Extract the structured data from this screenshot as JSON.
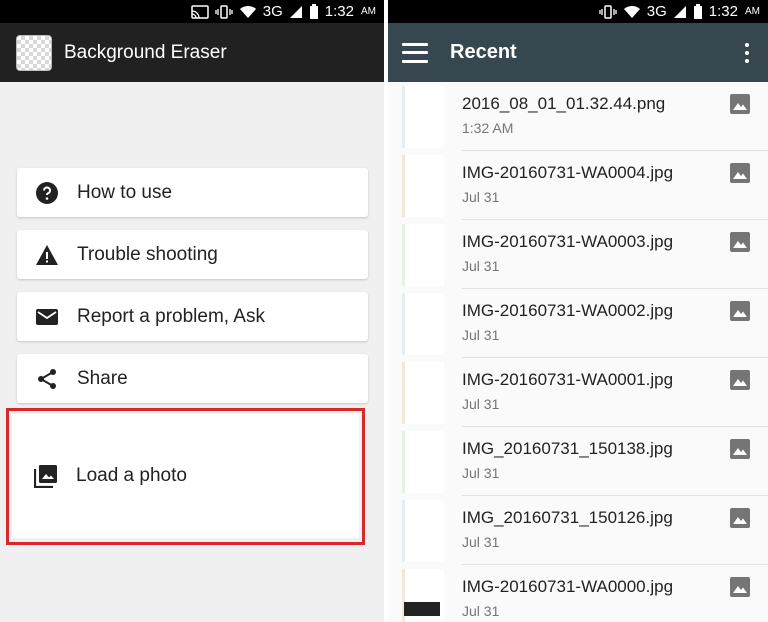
{
  "status": {
    "left_time": "1:32",
    "right_time": "1:32",
    "ampm": "AM",
    "network": "3G"
  },
  "left_app": {
    "title": "Background Eraser",
    "menu": [
      {
        "label": "How to use",
        "icon": "help-circle-icon"
      },
      {
        "label": "Trouble shooting",
        "icon": "warning-icon"
      },
      {
        "label": "Report a problem, Ask",
        "icon": "email-icon"
      },
      {
        "label": "Share",
        "icon": "share-icon"
      }
    ],
    "load": {
      "label": "Load a photo",
      "icon": "photo-library-icon"
    },
    "highlight_color": "#d9272e"
  },
  "right_app": {
    "title": "Recent",
    "files": [
      {
        "name": "2016_08_01_01.32.44.png",
        "date": "1:32 AM"
      },
      {
        "name": "IMG-20160731-WA0004.jpg",
        "date": "Jul 31"
      },
      {
        "name": "IMG-20160731-WA0003.jpg",
        "date": "Jul 31"
      },
      {
        "name": "IMG-20160731-WA0002.jpg",
        "date": "Jul 31"
      },
      {
        "name": "IMG-20160731-WA0001.jpg",
        "date": "Jul 31"
      },
      {
        "name": "IMG_20160731_150138.jpg",
        "date": "Jul 31"
      },
      {
        "name": "IMG_20160731_150126.jpg",
        "date": "Jul 31"
      },
      {
        "name": "IMG-20160731-WA0000.jpg",
        "date": "Jul 31"
      }
    ],
    "appbar_color": "#37474f"
  }
}
